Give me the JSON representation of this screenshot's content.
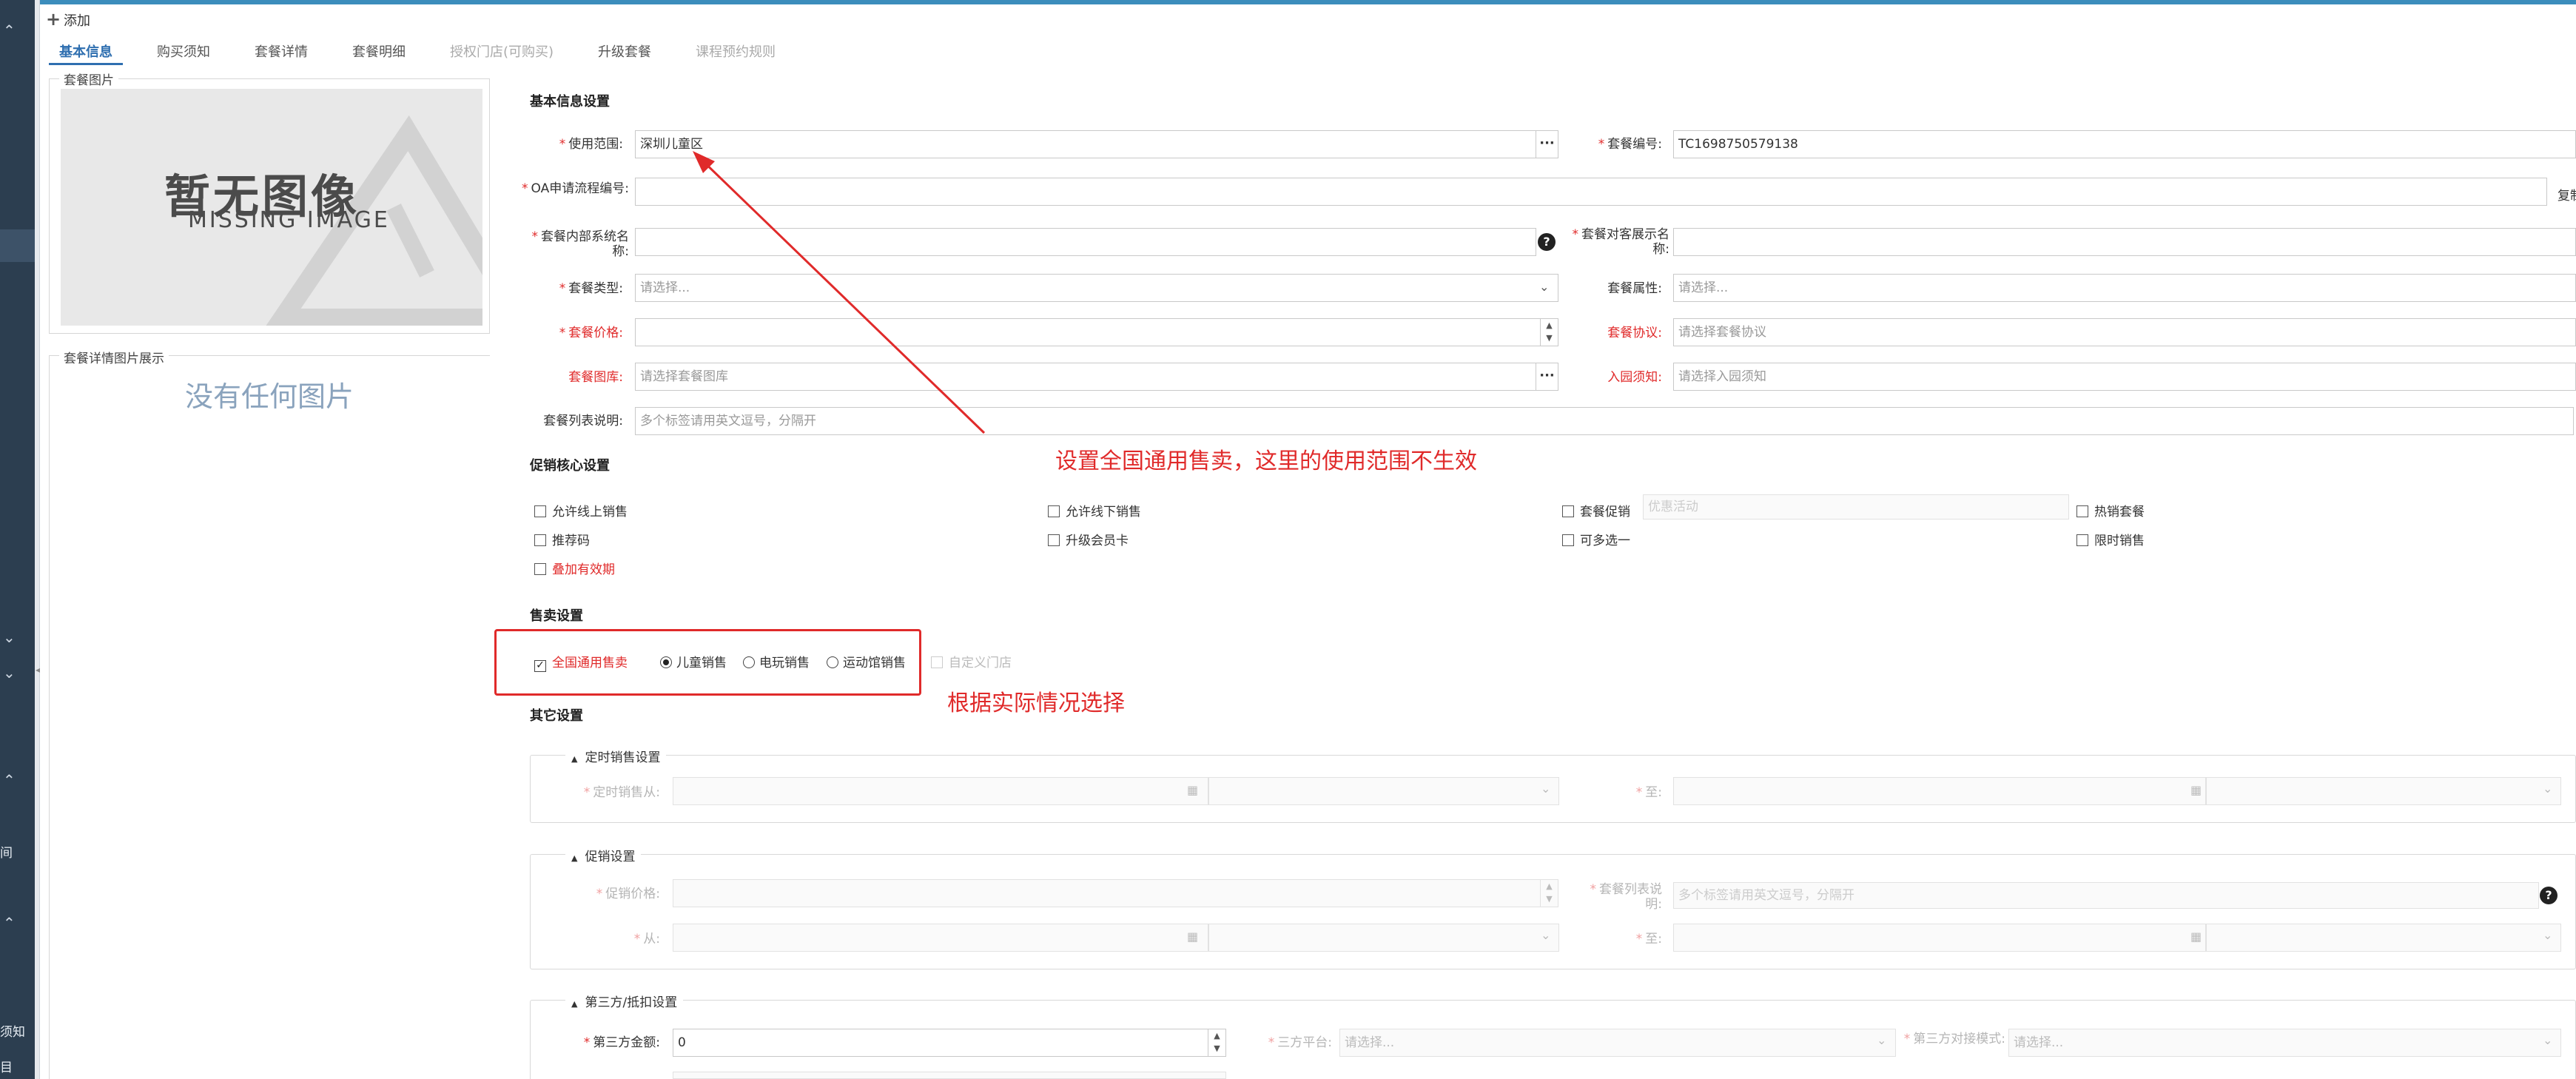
{
  "header": {
    "add_label": "添加"
  },
  "tabs": [
    {
      "label": "基本信息",
      "state": "active"
    },
    {
      "label": "购买须知",
      "state": "normal"
    },
    {
      "label": "套餐详情",
      "state": "normal"
    },
    {
      "label": "套餐明细",
      "state": "normal"
    },
    {
      "label": "授权门店(可购买)",
      "state": "disabled"
    },
    {
      "label": "升级套餐",
      "state": "normal"
    },
    {
      "label": "课程预约规则",
      "state": "disabled"
    }
  ],
  "left": {
    "image_group_label": "套餐图片",
    "missing_big": "暂无图像",
    "missing_small": "MISSING IMAGE",
    "detail_group_label": "套餐详情图片展示",
    "no_picture": "没有任何图片"
  },
  "rail": {
    "text_a": "间",
    "text_b": "须知",
    "text_c": "目"
  },
  "basic": {
    "title": "基本信息设置",
    "scope_label": "使用范围:",
    "scope_value": "深圳儿童区",
    "code_label": "套餐编号:",
    "code_value": "TC1698750579138",
    "oa_label": "OA申请流程编号:",
    "copy_btn": "复制",
    "internal_name_label": "套餐内部系统名称:",
    "display_name_label": "套餐对客展示名称:",
    "type_label": "套餐类型:",
    "type_placeholder": "请选择...",
    "attr_label": "套餐属性:",
    "attr_placeholder": "请选择...",
    "price_label": "套餐价格:",
    "agreement_label": "套餐协议:",
    "agreement_placeholder": "请选择套餐协议",
    "library_label": "套餐图库:",
    "library_placeholder": "请选择套餐图库",
    "notice_label": "入园须知:",
    "notice_placeholder": "请选择入园须知",
    "list_desc_label": "套餐列表说明:",
    "list_desc_placeholder": "多个标签请用英文逗号，分隔开"
  },
  "promo": {
    "title": "促销核心设置",
    "items": [
      {
        "label": "允许线上销售",
        "red": false
      },
      {
        "label": "允许线下销售",
        "red": false
      },
      {
        "label": "套餐促销",
        "red": false
      },
      {
        "label": "热销套餐",
        "red": false
      },
      {
        "label": "推荐码",
        "red": false
      },
      {
        "label": "升级会员卡",
        "red": false
      },
      {
        "label": "可多选一",
        "red": false
      },
      {
        "label": "限时销售",
        "red": false
      },
      {
        "label": "叠加有效期",
        "red": true
      }
    ],
    "promo_activity_placeholder": "优惠活动"
  },
  "sales": {
    "title": "售卖设置",
    "national_label": "全国通用售卖",
    "national_checked": true,
    "radios": [
      {
        "label": "儿童销售",
        "selected": true
      },
      {
        "label": "电玩销售",
        "selected": false
      },
      {
        "label": "运动馆销售",
        "selected": false
      }
    ],
    "custom_store_label": "自定义门店"
  },
  "other": {
    "title": "其它设置",
    "timed": {
      "legend": "定时销售设置",
      "from_label": "定时销售从:",
      "to_label": "至:"
    },
    "promo_set": {
      "legend": "促销设置",
      "price_label": "促销价格:",
      "list_desc_label": "套餐列表说明:",
      "list_desc_placeholder": "多个标签请用英文逗号，分隔开",
      "from_label": "从:",
      "to_label": "至:"
    },
    "third": {
      "legend": "第三方/抵扣设置",
      "amount_label": "第三方金额:",
      "amount_value": "0",
      "platform_label": "三方平台:",
      "platform_placeholder": "请选择...",
      "mode_label": "第三方对接模式:",
      "mode_placeholder": "请选择..."
    }
  },
  "annotations": {
    "note1": "设置全国通用售卖，这里的使用范围不生效",
    "note2": "根据实际情况选择"
  },
  "colors": {
    "accent": "#3c8dbc",
    "annotation": "#e02a2a",
    "rail": "#2c3e50"
  }
}
